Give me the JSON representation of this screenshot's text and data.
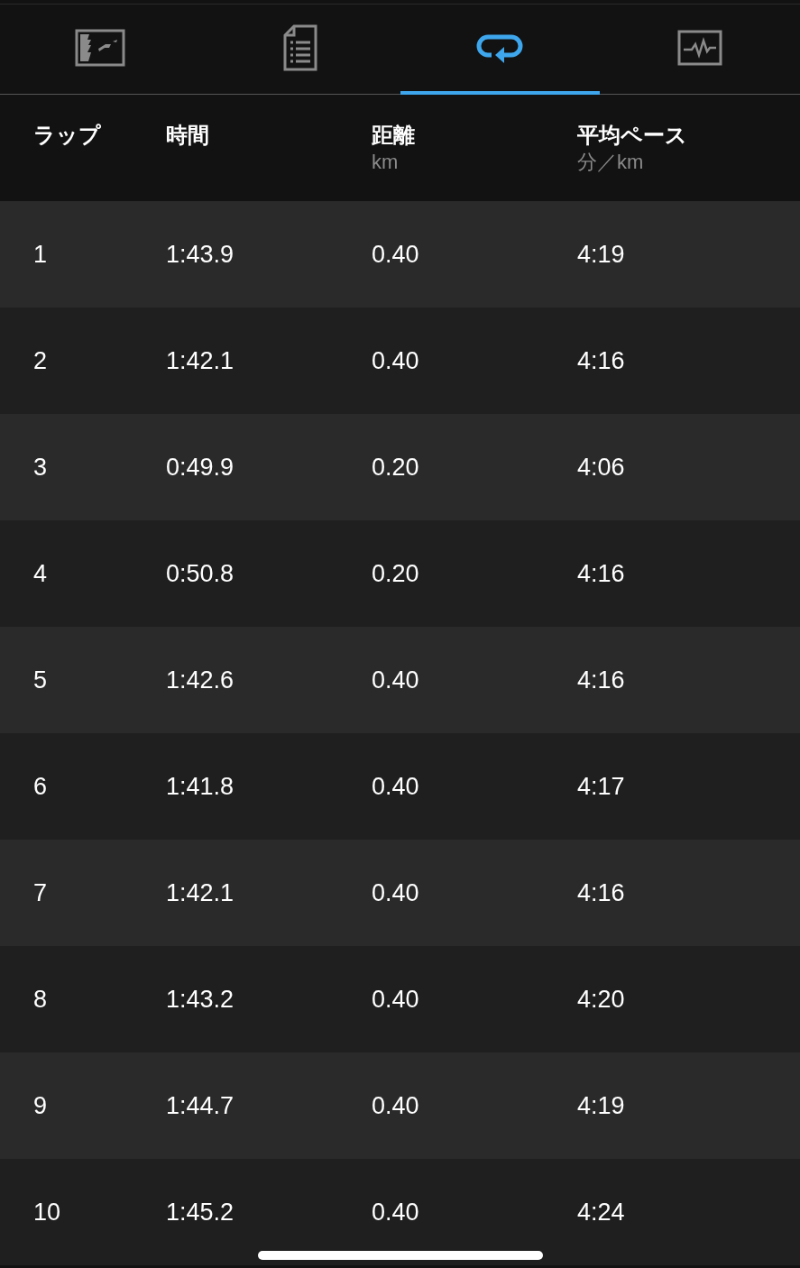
{
  "tabs": [
    {
      "kind": "map",
      "selected": false
    },
    {
      "kind": "details",
      "selected": false
    },
    {
      "kind": "laps",
      "selected": true
    },
    {
      "kind": "chart",
      "selected": false
    }
  ],
  "table": {
    "columns": [
      {
        "label": "ラップ"
      },
      {
        "label": "時間"
      },
      {
        "label": "距離",
        "unit": "km"
      },
      {
        "label": "平均ペース",
        "unit": "分／km"
      }
    ],
    "rows": [
      [
        "1",
        "1:43.9",
        "0.40",
        "4:19"
      ],
      [
        "2",
        "1:42.1",
        "0.40",
        "4:16"
      ],
      [
        "3",
        "0:49.9",
        "0.20",
        "4:06"
      ],
      [
        "4",
        "0:50.8",
        "0.20",
        "4:16"
      ],
      [
        "5",
        "1:42.6",
        "0.40",
        "4:16"
      ],
      [
        "6",
        "1:41.8",
        "0.40",
        "4:17"
      ],
      [
        "7",
        "1:42.1",
        "0.40",
        "4:16"
      ],
      [
        "8",
        "1:43.2",
        "0.40",
        "4:20"
      ],
      [
        "9",
        "1:44.7",
        "0.40",
        "4:19"
      ],
      [
        "10",
        "1:45.2",
        "0.40",
        "4:24"
      ]
    ]
  }
}
